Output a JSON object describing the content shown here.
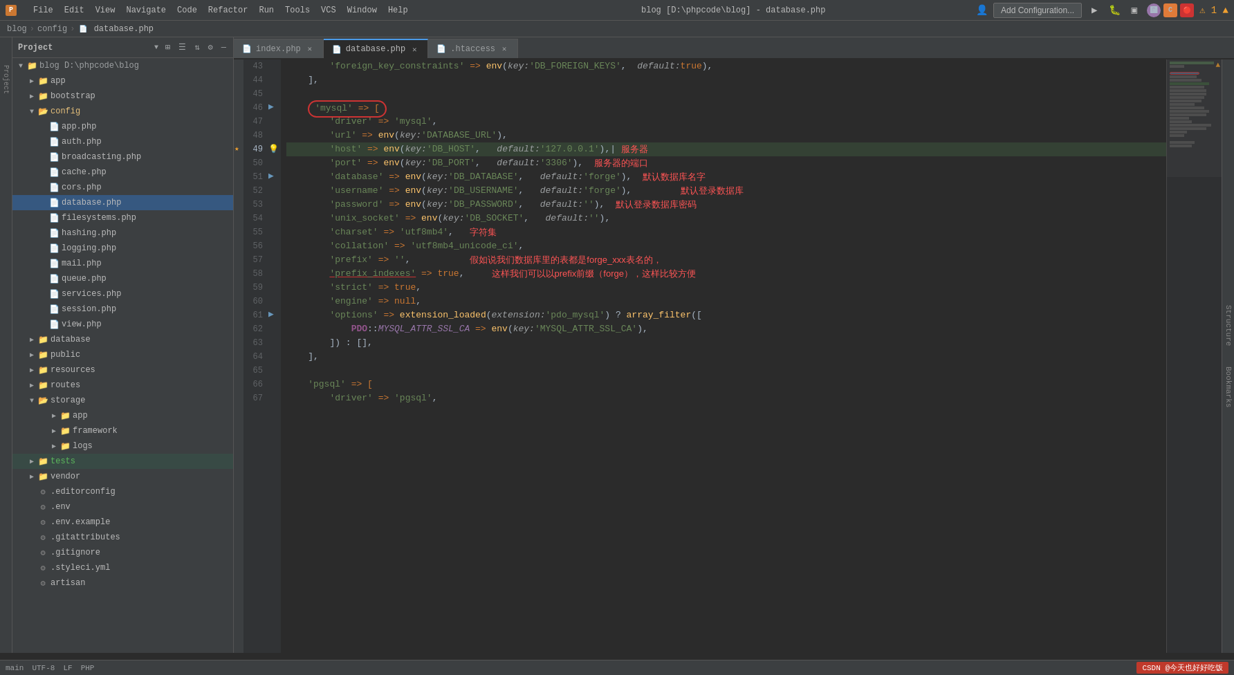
{
  "app": {
    "title": "blog [D:\\phpcode\\blog] - database.php",
    "icon": "🅿"
  },
  "menu": {
    "items": [
      "File",
      "Edit",
      "View",
      "Navigate",
      "Code",
      "Refactor",
      "Run",
      "Tools",
      "VCS",
      "Window",
      "Help"
    ]
  },
  "breadcrumb": {
    "items": [
      "blog",
      "config",
      "database.php"
    ],
    "separator": "›"
  },
  "tabs": [
    {
      "id": "index",
      "label": "index.php",
      "icon": "php",
      "active": false
    },
    {
      "id": "database",
      "label": "database.php",
      "icon": "php",
      "active": true
    },
    {
      "id": "htaccess",
      "label": ".htaccess",
      "icon": "file",
      "active": false
    }
  ],
  "project_panel": {
    "title": "Project",
    "root": "blog D:\\phpcode\\blog",
    "tree": [
      {
        "level": 0,
        "type": "folder",
        "label": "blog D:\\phpcode\\blog",
        "expanded": true
      },
      {
        "level": 1,
        "type": "folder",
        "label": "app",
        "expanded": false
      },
      {
        "level": 1,
        "type": "folder",
        "label": "bootstrap",
        "expanded": false
      },
      {
        "level": 1,
        "type": "folder",
        "label": "config",
        "expanded": true,
        "highlighted": true
      },
      {
        "level": 2,
        "type": "phpfile",
        "label": "app.php"
      },
      {
        "level": 2,
        "type": "phpfile",
        "label": "auth.php"
      },
      {
        "level": 2,
        "type": "phpfile",
        "label": "broadcasting.php"
      },
      {
        "level": 2,
        "type": "phpfile",
        "label": "cache.php"
      },
      {
        "level": 2,
        "type": "phpfile",
        "label": "cors.php"
      },
      {
        "level": 2,
        "type": "phpfile",
        "label": "database.php",
        "selected": true
      },
      {
        "level": 2,
        "type": "phpfile",
        "label": "filesystems.php"
      },
      {
        "level": 2,
        "type": "phpfile",
        "label": "hashing.php"
      },
      {
        "level": 2,
        "type": "phpfile",
        "label": "logging.php"
      },
      {
        "level": 2,
        "type": "phpfile",
        "label": "mail.php"
      },
      {
        "level": 2,
        "type": "phpfile",
        "label": "queue.php"
      },
      {
        "level": 2,
        "type": "phpfile",
        "label": "services.php"
      },
      {
        "level": 2,
        "type": "phpfile",
        "label": "session.php"
      },
      {
        "level": 2,
        "type": "phpfile",
        "label": "view.php"
      },
      {
        "level": 1,
        "type": "folder",
        "label": "database",
        "expanded": false
      },
      {
        "level": 1,
        "type": "folder",
        "label": "public",
        "expanded": false
      },
      {
        "level": 1,
        "type": "folder",
        "label": "resources",
        "expanded": false
      },
      {
        "level": 1,
        "type": "folder",
        "label": "routes",
        "expanded": false
      },
      {
        "level": 1,
        "type": "folder",
        "label": "storage",
        "expanded": true
      },
      {
        "level": 2,
        "type": "folder",
        "label": "app",
        "expanded": false
      },
      {
        "level": 2,
        "type": "folder",
        "label": "framework",
        "expanded": false
      },
      {
        "level": 2,
        "type": "folder",
        "label": "logs",
        "expanded": false
      },
      {
        "level": 1,
        "type": "folder",
        "label": "tests",
        "expanded": false,
        "highlighted": true
      },
      {
        "level": 1,
        "type": "folder",
        "label": "vendor",
        "expanded": false
      },
      {
        "level": 1,
        "type": "configfile",
        "label": ".editorconfig"
      },
      {
        "level": 1,
        "type": "configfile",
        "label": ".env"
      },
      {
        "level": 1,
        "type": "configfile",
        "label": ".env.example"
      },
      {
        "level": 1,
        "type": "configfile",
        "label": ".gitattributes"
      },
      {
        "level": 1,
        "type": "configfile",
        "label": ".gitignore"
      },
      {
        "level": 1,
        "type": "configfile",
        "label": ".styleci.yml"
      },
      {
        "level": 1,
        "type": "configfile",
        "label": "artisan"
      }
    ]
  },
  "editor": {
    "filename": "database.php",
    "lines": [
      {
        "num": 43,
        "content": "        'foreign_key_constraints' => env( key: 'DB_FOREIGN_KEYS',  default: true),"
      },
      {
        "num": 44,
        "content": "    ],"
      },
      {
        "num": 45,
        "content": ""
      },
      {
        "num": 46,
        "content": "    'mysql' => ["
      },
      {
        "num": 47,
        "content": "        'driver' => 'mysql',"
      },
      {
        "num": 48,
        "content": "        'url' => env( key: 'DATABASE_URL'),"
      },
      {
        "num": 49,
        "content": "        'host' => env( key: 'DB_HOST',   default: '127.0.0.1'),  服务器"
      },
      {
        "num": 50,
        "content": "        'port' => env( key: 'DB_PORT',   default: '3306'),  服务器的端口"
      },
      {
        "num": 51,
        "content": "        'database' => env( key: 'DB_DATABASE',   default: 'forge'),  默认数据库名字"
      },
      {
        "num": 52,
        "content": "        'username' => env( key: 'DB_USERNAME',   default: 'forge'),         默认登录数据库"
      },
      {
        "num": 53,
        "content": "        'password' => env( key: 'DB_PASSWORD',   default: ''),  默认登录数据库密码"
      },
      {
        "num": 54,
        "content": "        'unix_socket' => env( key: 'DB_SOCKET',   default: ''),"
      },
      {
        "num": 55,
        "content": "        'charset' => 'utf8mb4',   字符集"
      },
      {
        "num": 56,
        "content": "        'collation' => 'utf8mb4_unicode_ci',"
      },
      {
        "num": 57,
        "content": "        'prefix' => '',           假如说我们数据库里的表都是forge_xxx表名的，"
      },
      {
        "num": 58,
        "content": "        'prefix_indexes' => true,     这样我们可以以prefix前缀（forge），这样比较方便"
      },
      {
        "num": 59,
        "content": "        'strict' => true,"
      },
      {
        "num": 60,
        "content": "        'engine' => null,"
      },
      {
        "num": 61,
        "content": "        'options' => extension_loaded( extension: 'pdo_mysql') ? array_filter(["
      },
      {
        "num": 62,
        "content": "            PDO::MYSQL_ATTR_SSL_CA => env( key: 'MYSQL_ATTR_SSL_CA'),"
      },
      {
        "num": 63,
        "content": "        ]) : [],"
      },
      {
        "num": 64,
        "content": "    ],"
      },
      {
        "num": 65,
        "content": ""
      },
      {
        "num": 66,
        "content": "    'pgsql' => ["
      },
      {
        "num": 67,
        "content": "        'driver' => 'pgsql',"
      }
    ]
  },
  "statusbar": {
    "right_label": "CSDN @今天也好好吃饭",
    "warning": "⚠ 1 ▲"
  },
  "annotations": {
    "line49_note": "服务器",
    "line50_note": "服务器的端口",
    "line51_note": "默认数据库名字",
    "line52_note": "默认登录数据库",
    "line53_note": "默认登录数据库密码",
    "line55_note": "字符集",
    "line57_note": "假如说我们数据库里的表都是forge_xxx表名的，",
    "line58_note": "这样我们可以以prefix前缀（forge），这样比较方便"
  },
  "add_config_label": "Add Configuration...",
  "structure_labels": [
    "Structure",
    "Bookmarks"
  ],
  "panel_icons": [
    "⊞",
    "☰",
    "⇅",
    "⚙",
    "—"
  ]
}
